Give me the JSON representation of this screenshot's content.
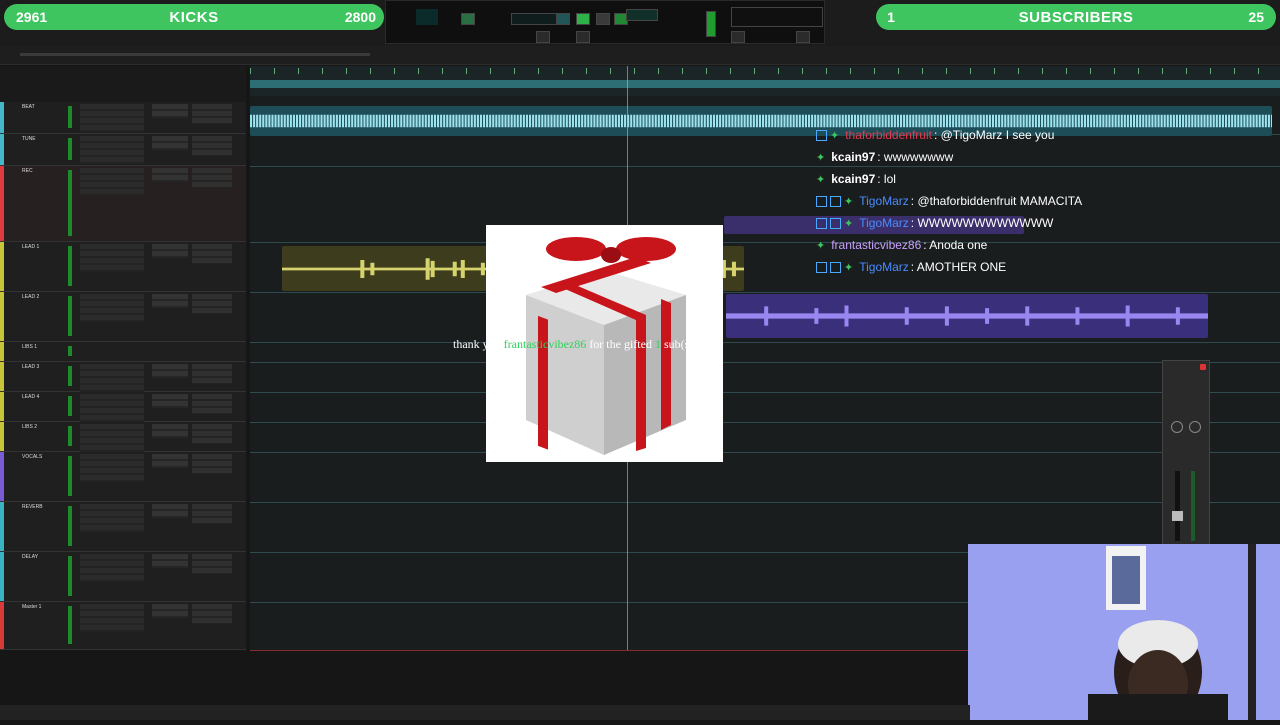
{
  "overlay": {
    "left_counter": {
      "value_left": "2961",
      "label": "KICKS",
      "value_right": "2800"
    },
    "right_counter": {
      "badge": "1",
      "label": "SUBSCRIBERS",
      "value": "25"
    }
  },
  "tracks": [
    {
      "name": "BEAT",
      "color": "#46b7c9"
    },
    {
      "name": "TUNE",
      "color": "#46b7c9"
    },
    {
      "name": "REC",
      "color": "#e0393e"
    },
    {
      "name": "LEAD 1",
      "color": "#c8c53a"
    },
    {
      "name": "LEAD 2",
      "color": "#c8c53a"
    },
    {
      "name": "LIBS 1",
      "color": "#c8c53a"
    },
    {
      "name": "LEAD 3",
      "color": "#c8c53a"
    },
    {
      "name": "LEAD 4",
      "color": "#c8c53a"
    },
    {
      "name": "LIBS 2",
      "color": "#c8c53a"
    },
    {
      "name": "VOCALS",
      "color": "#7a5bd6"
    },
    {
      "name": "REVERB",
      "color": "#3ab3c0"
    },
    {
      "name": "DELAY",
      "color": "#3ab3c0"
    },
    {
      "name": "Master 1",
      "color": "#d83a3a"
    }
  ],
  "chat": [
    {
      "user": "thaforbiddenfruit",
      "user_color": "#e23b4f",
      "message": ": @TigoMarz I see you",
      "badges": 1
    },
    {
      "user": "kcain97",
      "user_color": "#ffffff",
      "message": ": wwwwwwww",
      "badges": 0
    },
    {
      "user": "kcain97",
      "user_color": "#ffffff",
      "message": ": lol",
      "badges": 0
    },
    {
      "user": "TigoMarz",
      "user_color": "#4a8cff",
      "message": ": @thaforbiddenfruit MAMACITA",
      "badges": 2
    },
    {
      "user": "TigoMarz",
      "user_color": "#4a8cff",
      "message": ": WWWWWWWWWWWW",
      "badges": 2
    },
    {
      "user": "frantasticvibez86",
      "user_color": "#c9a0ff",
      "message": ": Anoda one",
      "badges": 0
    },
    {
      "user": "TigoMarz",
      "user_color": "#4a8cff",
      "message": ": AMOTHER ONE",
      "badges": 2
    }
  ],
  "alert": {
    "prefix": "thank you",
    "user": "frantasticvibez86",
    "middle": "for the gifted",
    "count": "1",
    "suffix": "sub(s)!"
  },
  "colors": {
    "accent_green": "#3fc55f",
    "audio_cyan": "#46b7c9",
    "audio_yellow": "#c8c53a",
    "audio_purple": "#7a5bd6"
  }
}
